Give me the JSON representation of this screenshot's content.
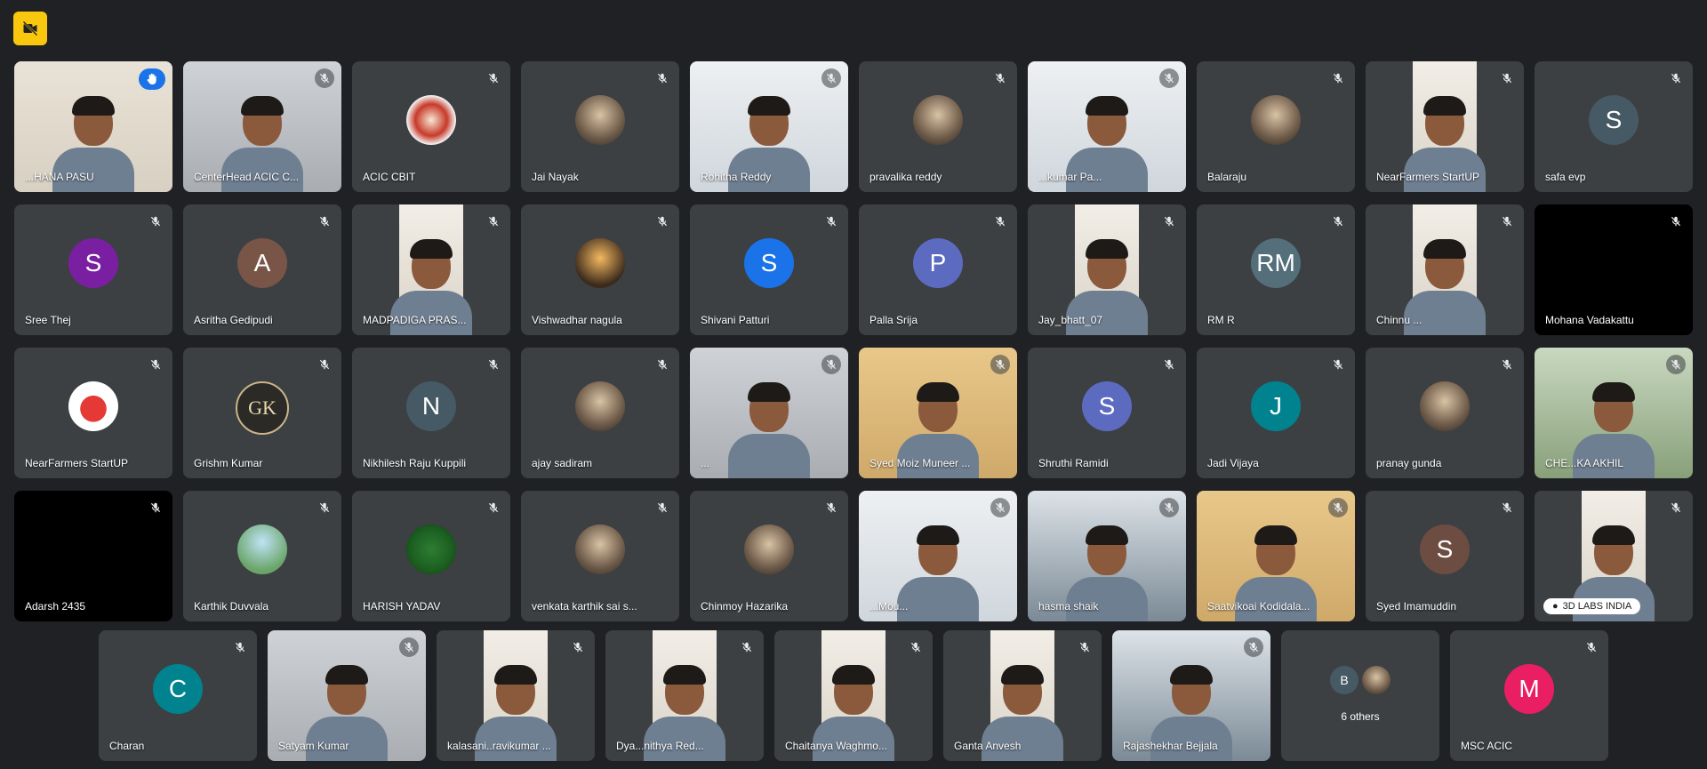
{
  "colors": {
    "background": "#202124",
    "tile": "#3c4043",
    "active_border": "#8ab4f8",
    "badge": "#f9c80e"
  },
  "top_badge": {
    "icon": "video-off-icon"
  },
  "participants": [
    {
      "name": "...HANA PASU",
      "type": "video",
      "bg": "beige",
      "active": true,
      "status": "hand-raised-icon"
    },
    {
      "name": "CenterHead ACIC C...",
      "type": "video",
      "bg": "grey",
      "status": "mic-off-icon"
    },
    {
      "name": "ACIC CBIT",
      "type": "photo",
      "photo": "logo",
      "status": "mic-off-icon"
    },
    {
      "name": "Jai Nayak",
      "type": "photo",
      "photo": "person",
      "status": "mic-off-icon"
    },
    {
      "name": "Rohitha Reddy",
      "type": "video",
      "bg": "light",
      "status": "mic-off-icon"
    },
    {
      "name": "pravalika reddy",
      "type": "photo",
      "photo": "person",
      "status": "mic-off-icon"
    },
    {
      "name": "...kumar Pa...",
      "type": "video",
      "bg": "light",
      "status": "mic-off-icon"
    },
    {
      "name": "Balaraju",
      "type": "photo",
      "photo": "person",
      "status": "mic-off-icon"
    },
    {
      "name": "NearFarmers StartUP",
      "type": "video",
      "bg": "strip",
      "status": "mic-off-icon"
    },
    {
      "name": "safa evp",
      "type": "initial",
      "initial": "S",
      "color": "#455a64",
      "status": "mic-off-icon"
    },
    {
      "name": "Sree Thej",
      "type": "initial",
      "initial": "S",
      "color": "#7b1fa2",
      "status": "mic-off-icon"
    },
    {
      "name": "Asritha Gedipudi",
      "type": "initial",
      "initial": "A",
      "color": "#795548",
      "status": "mic-off-icon"
    },
    {
      "name": "MADPADIGA PRAS...",
      "type": "video",
      "bg": "strip",
      "status": "mic-off-icon"
    },
    {
      "name": "Vishwadhar nagula",
      "type": "photo",
      "photo": "dusk",
      "status": "mic-off-icon"
    },
    {
      "name": "Shivani Patturi",
      "type": "initial",
      "initial": "S",
      "color": "#1a73e8",
      "status": "mic-off-icon"
    },
    {
      "name": "Palla Srija",
      "type": "initial",
      "initial": "P",
      "color": "#5c6bc0",
      "status": "mic-off-icon"
    },
    {
      "name": "Jay_bhatt_07",
      "type": "video",
      "bg": "strip",
      "status": "mic-off-icon"
    },
    {
      "name": "RM R",
      "type": "initial",
      "initial": "RM",
      "color": "#546e7a",
      "status": "mic-off-icon"
    },
    {
      "name": "Chinnu ...",
      "type": "video",
      "bg": "strip",
      "status": "mic-off-icon"
    },
    {
      "name": "Mohana Vadakattu",
      "type": "dark",
      "status": "mic-off-icon"
    },
    {
      "name": "NearFarmers StartUP",
      "type": "photo",
      "photo": "nf",
      "status": "mic-off-icon"
    },
    {
      "name": "Grishm Kumar",
      "type": "photo",
      "photo": "gk",
      "text": "GK",
      "status": "mic-off-icon"
    },
    {
      "name": "Nikhilesh Raju Kuppili",
      "type": "initial",
      "initial": "N",
      "color": "#455a64",
      "status": "mic-off-icon"
    },
    {
      "name": "ajay sadiram",
      "type": "photo",
      "photo": "person",
      "status": "mic-off-icon"
    },
    {
      "name": "...",
      "type": "video",
      "bg": "grey",
      "status": "mic-off-icon"
    },
    {
      "name": "Syed Moiz Muneer ...",
      "type": "video",
      "bg": "warm",
      "status": "mic-off-icon"
    },
    {
      "name": "Shruthi Ramidi",
      "type": "initial",
      "initial": "S",
      "color": "#5c6bc0",
      "status": "mic-off-icon"
    },
    {
      "name": "Jadi Vijaya",
      "type": "initial",
      "initial": "J",
      "color": "#00838f",
      "status": "mic-off-icon"
    },
    {
      "name": "pranay gunda",
      "type": "photo",
      "photo": "person",
      "status": "mic-off-icon"
    },
    {
      "name": "CHE...KA AKHIL",
      "type": "video",
      "bg": "green",
      "status": "mic-off-icon"
    },
    {
      "name": "Adarsh 2435",
      "type": "dark",
      "status": "mic-off-icon"
    },
    {
      "name": "Karthik Duvvala",
      "type": "photo",
      "photo": "sky",
      "status": "mic-off-icon"
    },
    {
      "name": "HARISH YADAV",
      "type": "photo",
      "photo": "green",
      "status": "mic-off-icon"
    },
    {
      "name": "venkata karthik sai s...",
      "type": "photo",
      "photo": "person",
      "status": "mic-off-icon"
    },
    {
      "name": "Chinmoy Hazarika",
      "type": "photo",
      "photo": "person",
      "status": "mic-off-icon"
    },
    {
      "name": "...Mou...",
      "type": "video",
      "bg": "light",
      "status": "mic-off-icon"
    },
    {
      "name": "hasma shaik",
      "type": "video",
      "bg": "room",
      "status": "mic-off-icon"
    },
    {
      "name": "Saatvikoai Kodidala...",
      "type": "video",
      "bg": "warm",
      "status": "mic-off-icon"
    },
    {
      "name": "Syed Imamuddin",
      "type": "initial",
      "initial": "S",
      "color": "#6d4c41",
      "status": "mic-off-icon"
    },
    {
      "name": "3D LABS INDIA",
      "type": "video",
      "bg": "strip",
      "chip": true,
      "status": "mic-off-icon"
    }
  ],
  "last_row": [
    {
      "name": "Charan",
      "type": "initial",
      "initial": "C",
      "color": "#00838f",
      "status": "mic-off-icon"
    },
    {
      "name": "Satyam Kumar",
      "type": "video",
      "bg": "grey",
      "status": "mic-off-icon"
    },
    {
      "name": "kalasani..ravikumar ...",
      "type": "video",
      "bg": "strip",
      "status": "mic-off-icon"
    },
    {
      "name": "Dya...nithya Red...",
      "type": "video",
      "bg": "strip",
      "status": "mic-off-icon"
    },
    {
      "name": "Chaitanya Waghmo...",
      "type": "video",
      "bg": "strip",
      "status": "mic-off-icon"
    },
    {
      "name": "Ganta Anvesh",
      "type": "video",
      "bg": "strip",
      "status": "mic-off-icon"
    },
    {
      "name": "Rajashekhar Bejjala",
      "type": "video",
      "bg": "room",
      "status": "mic-off-icon"
    },
    {
      "name": "6 others",
      "type": "others",
      "initial": "B",
      "color": "#455a64",
      "status": ""
    },
    {
      "name": "MSC ACIC",
      "type": "initial",
      "initial": "M",
      "color": "#e91e63",
      "status": "mic-off-icon"
    }
  ]
}
